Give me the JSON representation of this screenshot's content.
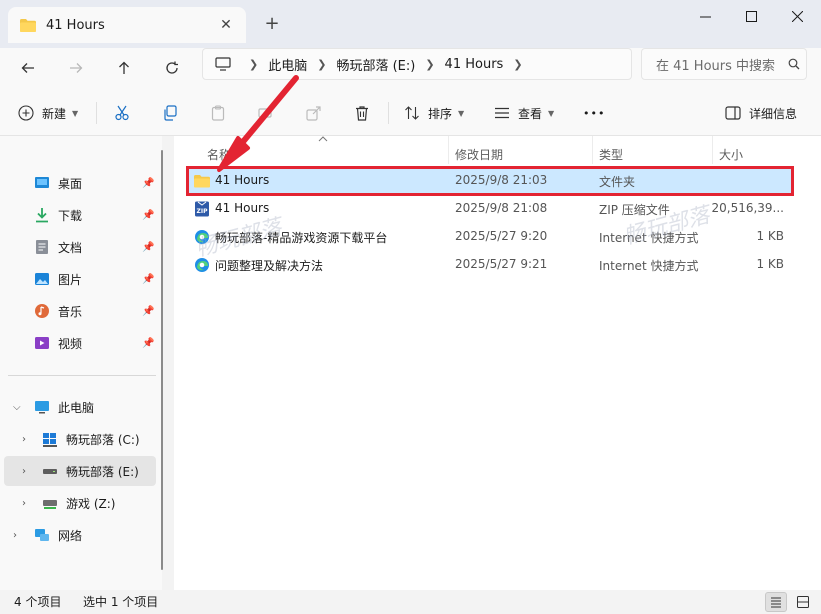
{
  "tab": {
    "title": "41 Hours",
    "close": "✕",
    "new": "+"
  },
  "window": {
    "minimize": "—",
    "maximize": "☐",
    "close": "✕"
  },
  "breadcrumb": [
    "此电脑",
    "畅玩部落 (E:)",
    "41 Hours"
  ],
  "search": {
    "placeholder": "在 41 Hours 中搜索"
  },
  "toolbar": {
    "new_label": "新建",
    "sort_label": "排序",
    "view_label": "查看",
    "more_label": "•••",
    "details_label": "详细信息"
  },
  "sidebar": {
    "quick": [
      {
        "label": "桌面",
        "icon": "desktop-icon",
        "color": "#1e88d6"
      },
      {
        "label": "下载",
        "icon": "download-icon",
        "color": "#2aa861"
      },
      {
        "label": "文档",
        "icon": "document-icon",
        "color": "#8a8f98"
      },
      {
        "label": "图片",
        "icon": "pictures-icon",
        "color": "#1b84d8"
      },
      {
        "label": "音乐",
        "icon": "music-icon",
        "color": "#e06a3a"
      },
      {
        "label": "视频",
        "icon": "video-icon",
        "color": "#8a3fc6"
      }
    ],
    "this_pc": "此电脑",
    "drives": [
      "畅玩部落 (C:)",
      "畅玩部落 (E:)",
      "游戏 (Z:)"
    ],
    "network": "网络"
  },
  "columns": {
    "name": "名称",
    "date": "修改日期",
    "type": "类型",
    "size": "大小"
  },
  "files": [
    {
      "name": "41 Hours",
      "date": "2025/9/8 21:03",
      "type": "文件夹",
      "size": "",
      "icon": "folder-icon"
    },
    {
      "name": "41 Hours",
      "date": "2025/9/8 21:08",
      "type": "ZIP 压缩文件",
      "size": "20,516,39...",
      "icon": "zip-icon"
    },
    {
      "name": "畅玩部落-精品游戏资源下载平台",
      "date": "2025/5/27 9:20",
      "type": "Internet 快捷方式",
      "size": "1 KB",
      "icon": "edge-icon"
    },
    {
      "name": "问题整理及解决方法",
      "date": "2025/5/27 9:21",
      "type": "Internet 快捷方式",
      "size": "1 KB",
      "icon": "edge-icon"
    }
  ],
  "watermarks": [
    "畅玩部落",
    "畅玩部落"
  ],
  "status": {
    "count": "4 个项目",
    "selected": "选中 1 个项目"
  },
  "colors": {
    "selection": "#cce8ff",
    "highlight_box": "#e32432",
    "arrow": "#e32432"
  }
}
